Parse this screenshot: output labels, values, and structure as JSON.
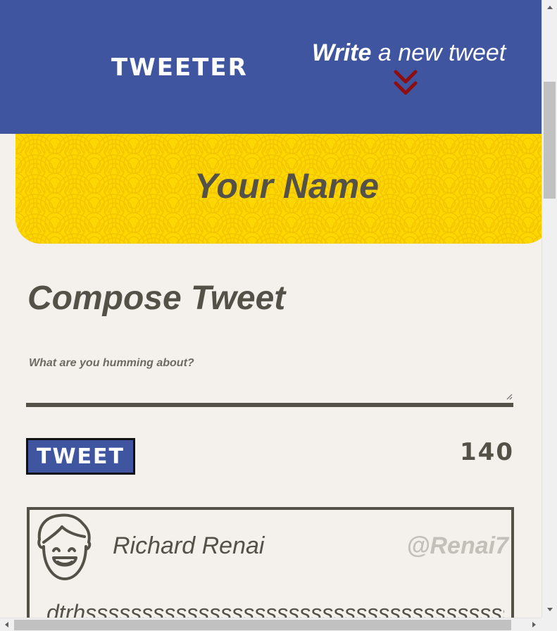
{
  "nav": {
    "brand": "Tweeter",
    "write_bold": "Write",
    "write_rest": " a new tweet",
    "chevron_icon": "double-chevron-down-icon",
    "chevron_color": "#8b0f12",
    "background": "#3f55a0"
  },
  "profile": {
    "name": "Your Name",
    "banner_color": "#fdd700"
  },
  "compose": {
    "title": "Compose Tweet",
    "placeholder": "What are you humming about?",
    "button_label": "Tweet",
    "counter": "140"
  },
  "tweets": [
    {
      "avatar_icon": "smiling-face-avatar-icon",
      "name": "Richard Renai",
      "handle": "@Renai7",
      "text": "dtrhssssssssssssssssssssssssssssssssssssssssssss"
    }
  ],
  "colors": {
    "text": "#545149",
    "page_background": "#f4f1ed",
    "handle": "#c3c0ba"
  }
}
